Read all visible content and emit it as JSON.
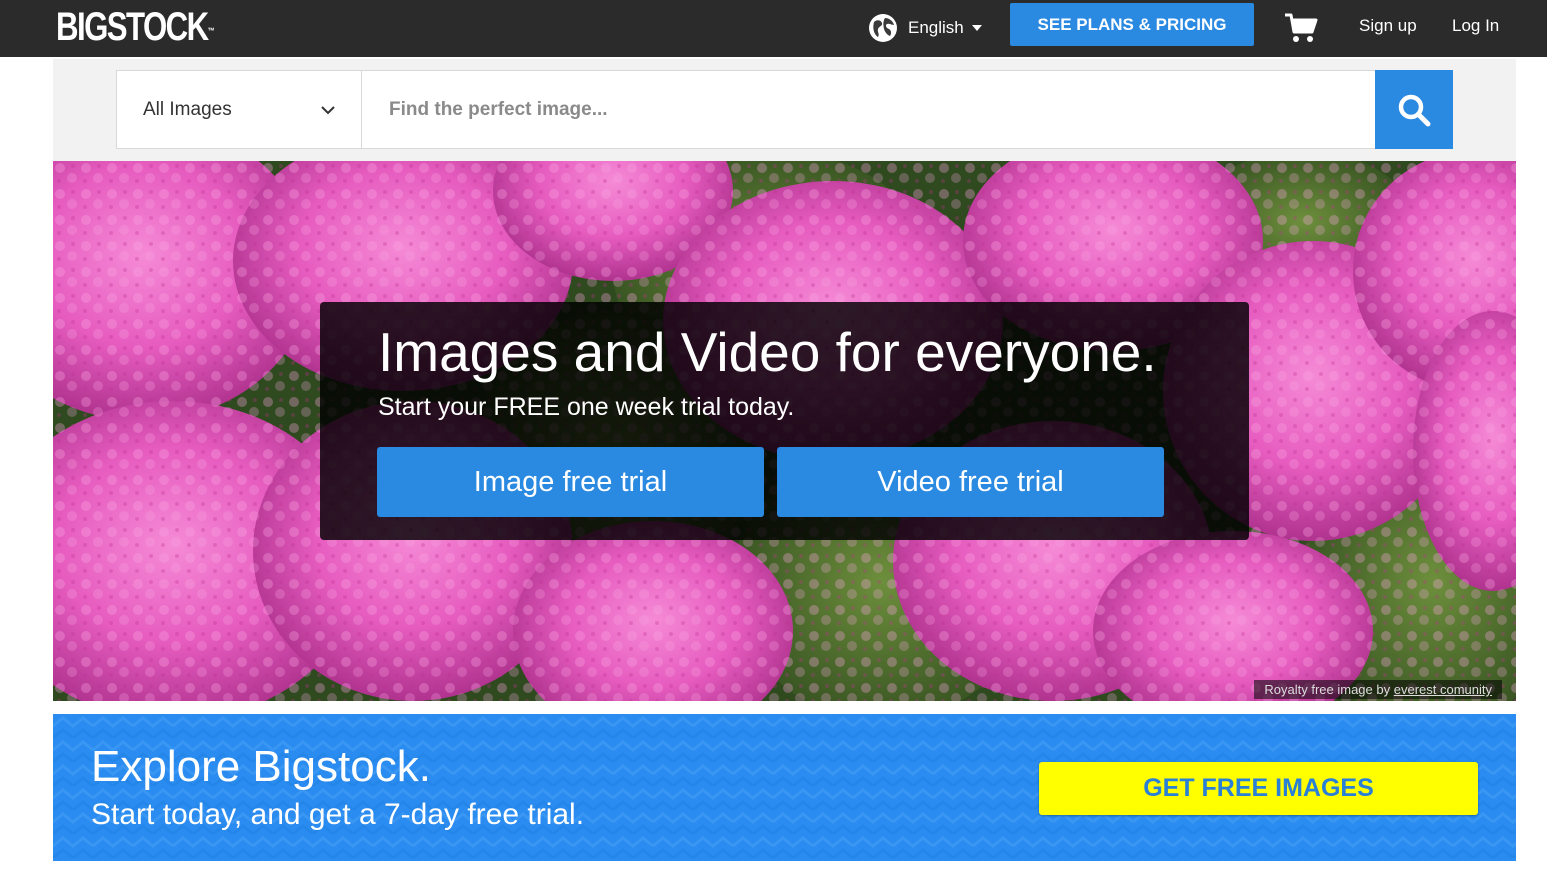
{
  "header": {
    "logo_text": "BIGSTOCK",
    "logo_tm": "™",
    "language": "English",
    "language_icon": "globe-icon",
    "plans_label": "SEE PLANS & PRICING",
    "cart_icon": "cart-icon",
    "signup_label": "Sign up",
    "login_label": "Log In"
  },
  "search": {
    "category": "All Images",
    "placeholder": "Find the perfect image...",
    "search_icon": "search-icon"
  },
  "hero": {
    "title": "Images and Video for everyone.",
    "subtitle": "Start your FREE one week trial today.",
    "image_trial_label": "Image free trial",
    "video_trial_label": "Video free trial",
    "credit_prefix": "Royalty free image by ",
    "credit_author": "everest comunity"
  },
  "explore": {
    "title": "Explore Bigstock.",
    "subtitle": "Start today, and get a 7-day free trial.",
    "cta_label": "GET FREE IMAGES"
  },
  "colors": {
    "topbar": "#2b2b2b",
    "accent_blue": "#2a89e0",
    "banner_blue": "#2a8cf0",
    "cta_yellow": "#ffff00",
    "flower_pink": "#e85fc0"
  }
}
